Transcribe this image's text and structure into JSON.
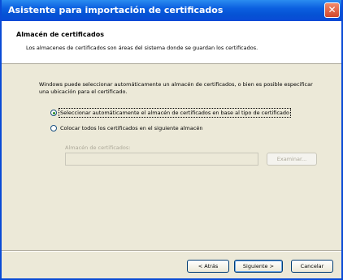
{
  "window": {
    "title": "Asistente para importación de certificados",
    "close_glyph": "✕"
  },
  "header": {
    "title": "Almacén de certificados",
    "subtitle": "Los almacenes de certificados son áreas del sistema donde se guardan los certificados."
  },
  "main": {
    "description": "Windows puede seleccionar automáticamente un almacén de certificados, o bien es posible especificar una ubicación para el certificado.",
    "options": [
      {
        "label": "Seleccionar automáticamente el almacén de certificados en base al tipo de certificado",
        "selected": true
      },
      {
        "label": "Colocar todos los certificados en el siguiente almacén",
        "selected": false
      }
    ],
    "store": {
      "label": "Almacén de certificados:",
      "value": "",
      "browse_label": "Examinar..."
    }
  },
  "footer": {
    "back_label": "< Atrás",
    "next_label": "Siguiente >",
    "cancel_label": "Cancelar"
  },
  "colors": {
    "titlebar": "#0a4bd6",
    "dialog_bg": "#ece9d8",
    "radio_dot": "#2a8a20"
  }
}
